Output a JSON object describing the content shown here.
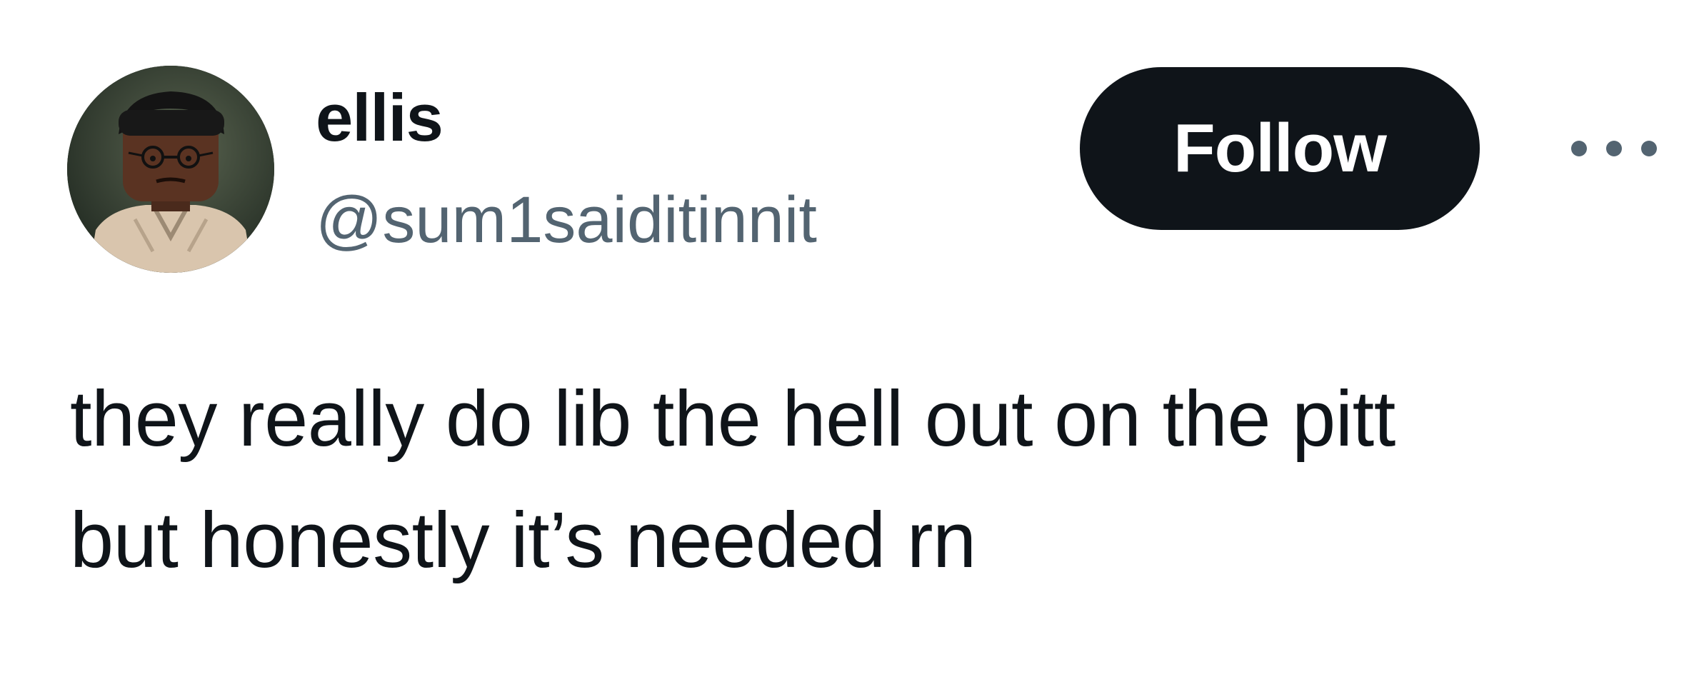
{
  "author": {
    "display_name": "ellis",
    "handle": "@sum1saiditinnit",
    "avatar_icon": "lego-minifigure-avatar"
  },
  "actions": {
    "follow_label": "Follow",
    "more_icon": "more-horizontal-icon"
  },
  "tweet": {
    "lines": [
      "they really do lib the hell out on the pitt",
      "but honestly it’s needed rn"
    ]
  },
  "colors": {
    "text_primary": "#0f1419",
    "text_secondary": "#536471",
    "button_bg": "#0f1419",
    "button_text": "#ffffff",
    "background": "#ffffff"
  }
}
